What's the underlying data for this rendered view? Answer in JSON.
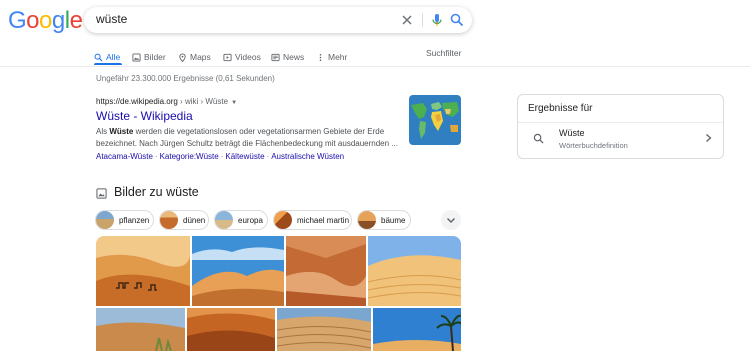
{
  "logo": {
    "letters": [
      "G",
      "o",
      "o",
      "g",
      "l",
      "e"
    ]
  },
  "search": {
    "query": "wüste"
  },
  "tabs": [
    {
      "label": "Alle",
      "icon": "search-icon"
    },
    {
      "label": "Bilder",
      "icon": "image-icon"
    },
    {
      "label": "Maps",
      "icon": "map-pin-icon"
    },
    {
      "label": "Videos",
      "icon": "video-icon"
    },
    {
      "label": "News",
      "icon": "news-icon"
    },
    {
      "label": "Mehr",
      "icon": "more-vertical-icon"
    }
  ],
  "tools_label": "Suchfilter",
  "result_stats": "Ungefähr 23.300.000 Ergebnisse (0,61 Sekunden)",
  "wiki_result": {
    "cite_domain": "https://de.wikipedia.org",
    "cite_path": " › wiki › Wüste",
    "title": "Wüste - Wikipedia",
    "snippet_pre": "Als ",
    "snippet_bold": "Wüste",
    "snippet_post": " werden die vegetationslosen oder vegetationsarmen Gebiete der Erde bezeichnet. Nach Jürgen Schultz beträgt die Flächenbedeckung mit ausdauernden ...",
    "sitelinks": [
      "Atacama-Wüste",
      "Kategorie:Wüste",
      "Kältewüste",
      "Australische Wüsten"
    ],
    "sitelink_separator": "·"
  },
  "images_section": {
    "title": "Bilder zu wüste",
    "chips": [
      "pflanzen",
      "dünen",
      "europa",
      "michael martin",
      "bäume"
    ]
  },
  "knowledge_panel": {
    "title": "Ergebnisse für",
    "word": "Wüste",
    "subtitle": "Wörterbuchdefinition"
  },
  "colors": {
    "link": "#1a0dab",
    "accent": "#1a73e8",
    "sand": "#d99a4e"
  }
}
